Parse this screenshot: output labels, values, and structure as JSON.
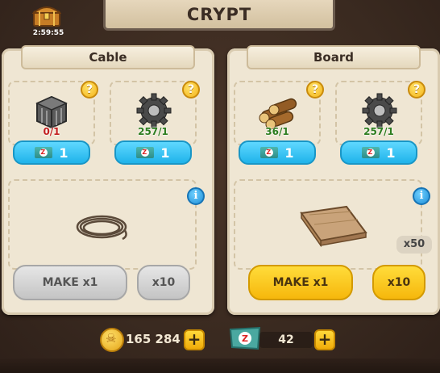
{
  "header": {
    "title": "CRYPT",
    "timer": "2:59:55"
  },
  "recipes": [
    {
      "name": "Cable",
      "ingredients": [
        {
          "icon": "iron-crate-icon",
          "count": "0/1",
          "status": "insufficient"
        },
        {
          "icon": "gear-icon",
          "count": "257/1",
          "status": "sufficient"
        }
      ],
      "ticket_costs": [
        "1",
        "1"
      ],
      "product_icon": "rope-coil-icon",
      "quantity_badge": "",
      "make_label": "MAKE x1",
      "make10_label": "x10",
      "enabled": false
    },
    {
      "name": "Board",
      "ingredients": [
        {
          "icon": "logs-icon",
          "count": "36/1",
          "status": "sufficient"
        },
        {
          "icon": "gear-icon",
          "count": "257/1",
          "status": "sufficient"
        }
      ],
      "ticket_costs": [
        "1",
        "1"
      ],
      "product_icon": "wood-plank-icon",
      "quantity_badge": "x50",
      "make_label": "MAKE x1",
      "make10_label": "x10",
      "enabled": true
    }
  ],
  "footer": {
    "gold": "165 284",
    "tickets": "42",
    "ticket_glyph": "Z"
  },
  "help_glyph": "?",
  "info_glyph": "i",
  "plus_glyph": "+"
}
